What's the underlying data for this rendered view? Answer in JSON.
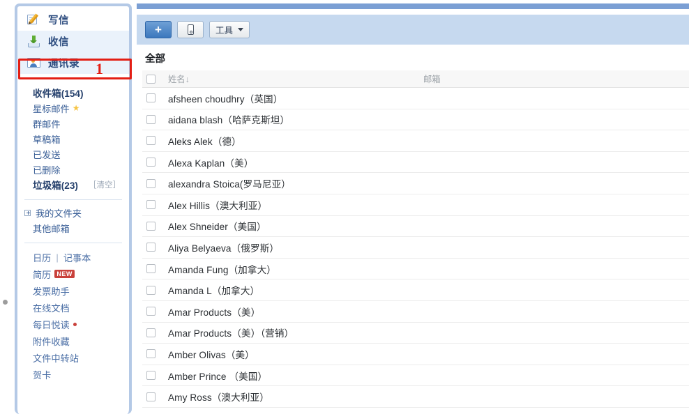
{
  "sidebar": {
    "nav": [
      {
        "label": "写信",
        "icon": "compose-icon"
      },
      {
        "label": "收信",
        "icon": "inbox-icon"
      },
      {
        "label": "通讯录",
        "icon": "contacts-icon"
      }
    ],
    "folders": [
      {
        "label": "收件箱(154)",
        "bold": true,
        "action": ""
      },
      {
        "label": "星标邮件",
        "bold": false,
        "action": "",
        "star": "★"
      },
      {
        "label": "群邮件",
        "bold": false,
        "action": ""
      },
      {
        "label": "草稿箱",
        "bold": false,
        "action": ""
      },
      {
        "label": "已发送",
        "bold": false,
        "action": ""
      },
      {
        "label": "已删除",
        "bold": false,
        "action": ""
      },
      {
        "label": "垃圾箱(23)",
        "bold": true,
        "action": "［清空］"
      }
    ],
    "tree": [
      {
        "label": "我的文件夹",
        "toggle": true
      },
      {
        "label": "其他邮箱",
        "toggle": false
      }
    ],
    "apps": {
      "calendar": "日历",
      "divider": "|",
      "notes": "记事本",
      "items": [
        {
          "label": "简历",
          "badge": "NEW"
        },
        {
          "label": "发票助手",
          "badge": ""
        },
        {
          "label": "在线文档",
          "badge": ""
        },
        {
          "label": "每日悦读",
          "dot": true
        },
        {
          "label": "附件收藏",
          "badge": ""
        },
        {
          "label": "文件中转站",
          "badge": ""
        },
        {
          "label": "贺卡",
          "badge": ""
        }
      ]
    }
  },
  "annotation": {
    "number": "1",
    "color": "#e31e14"
  },
  "toolbar": {
    "add_label": "+",
    "mobile_label": "",
    "tools_label": "工具"
  },
  "main": {
    "list_title": "全部",
    "columns": {
      "name": "姓名↓",
      "email": "邮箱"
    },
    "contacts": [
      {
        "name": "afsheen choudhry（英国）",
        "email": ""
      },
      {
        "name": "aidana blash（哈萨克斯坦）",
        "email": ""
      },
      {
        "name": "Aleks Alek（德）",
        "email": ""
      },
      {
        "name": " Alexa Kaplan（美）",
        "email": ""
      },
      {
        "name": "alexandra Stoica(罗马尼亚）",
        "email": ""
      },
      {
        "name": "Alex Hillis（澳大利亚）",
        "email": ""
      },
      {
        "name": "Alex Shneider（美国）",
        "email": ""
      },
      {
        "name": "Aliya Belyaeva（俄罗斯）",
        "email": ""
      },
      {
        "name": "Amanda Fung（加拿大）",
        "email": ""
      },
      {
        "name": "Amanda L（加拿大）",
        "email": ""
      },
      {
        "name": "Amar Products（美）",
        "email": ""
      },
      {
        "name": "Amar Products（美）（营销）",
        "email": ""
      },
      {
        "name": " Amber Olivas（美）",
        "email": ""
      },
      {
        "name": "Amber Prince  （美国）",
        "email": ""
      },
      {
        "name": " Amy Ross（澳大利亚）",
        "email": ""
      }
    ]
  },
  "colors": {
    "top_bar": "#7b9fd4",
    "toolbar_bg": "#c6d9ef",
    "sidebar_border": "#b4c9e6",
    "primary_button": "#3c78bd",
    "annotation_red": "#e31e14",
    "badge_red": "#c9413b"
  }
}
